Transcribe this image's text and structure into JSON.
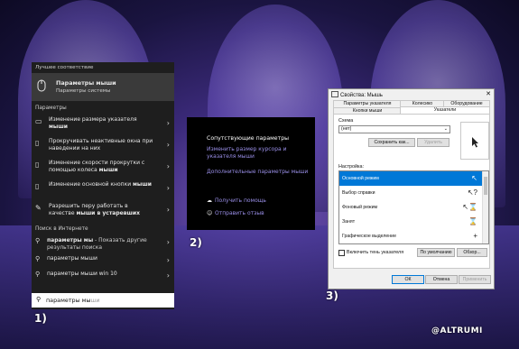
{
  "panel1": {
    "best_match_header": "Лучшее соответствие",
    "best_match": {
      "title": "Параметры мыши",
      "subtitle": "Параметры системы",
      "icon": "mouse-icon"
    },
    "settings_header": "Параметры",
    "settings": [
      {
        "label": "Изменение размера указателя",
        "bold": "мыши",
        "icon": "display-icon"
      },
      {
        "label": "Прокручивать неактивные окна при наведении на них",
        "bold": "",
        "icon": "mouse-icon"
      },
      {
        "label": "Изменение скорости прокрутки с помощью колеса",
        "bold": "мыши",
        "icon": "mouse-icon"
      },
      {
        "label": "Изменение основной кнопки",
        "bold": "мыши",
        "icon": "mouse-icon"
      },
      {
        "label": "Разрешить перу работать в качестве",
        "bold": "мыши в устаревших",
        "icon": "pen-icon"
      }
    ],
    "web_header": "Поиск в Интернете",
    "web": [
      {
        "label": "параметры мы",
        "suffix": " - Показать другие результаты поиска"
      },
      {
        "label": "параметры мыши",
        "suffix": ""
      },
      {
        "label": "параметры мыши win 10",
        "suffix": ""
      }
    ],
    "search": {
      "typed": "параметры мы",
      "ghost": "ши"
    }
  },
  "panel2": {
    "title": "Сопутствующие параметры",
    "links": [
      "Изменить размер курсора и указателя мыши",
      "Дополнительные параметры мыши"
    ],
    "help": [
      {
        "label": "Получить помощь",
        "icon": "help-icon"
      },
      {
        "label": "Отправить отзыв",
        "icon": "feedback-icon"
      }
    ]
  },
  "dialog": {
    "title": "Свойства: Мышь",
    "tabs_row1": [
      "Параметры указателя",
      "Колесико",
      "Оборудование"
    ],
    "tabs_row2": [
      "Кнопки мыши",
      "Указатели"
    ],
    "scheme_label": "Схема",
    "scheme_value": "(нет)",
    "save_as": "Сохранить как...",
    "delete": "Удалить",
    "customize_label": "Настройка:",
    "cursors": [
      {
        "name": "Основной режим",
        "icon": "arrow-cursor-icon",
        "selected": true
      },
      {
        "name": "Выбор справки",
        "icon": "help-cursor-icon",
        "selected": false
      },
      {
        "name": "Фоновый режим",
        "icon": "busy-arrow-cursor-icon",
        "selected": false
      },
      {
        "name": "Занят",
        "icon": "hourglass-icon",
        "selected": false
      },
      {
        "name": "Графическое выделение",
        "icon": "crosshair-icon",
        "selected": false
      }
    ],
    "shadow_label": "Включить тень указателя",
    "default_btn": "По умолчанию",
    "browse_btn": "Обзор...",
    "ok": "ОК",
    "cancel": "Отмена",
    "apply": "Применить"
  },
  "steps": [
    "1)",
    "2)",
    "3)"
  ],
  "watermark": "@ALTRUMI"
}
